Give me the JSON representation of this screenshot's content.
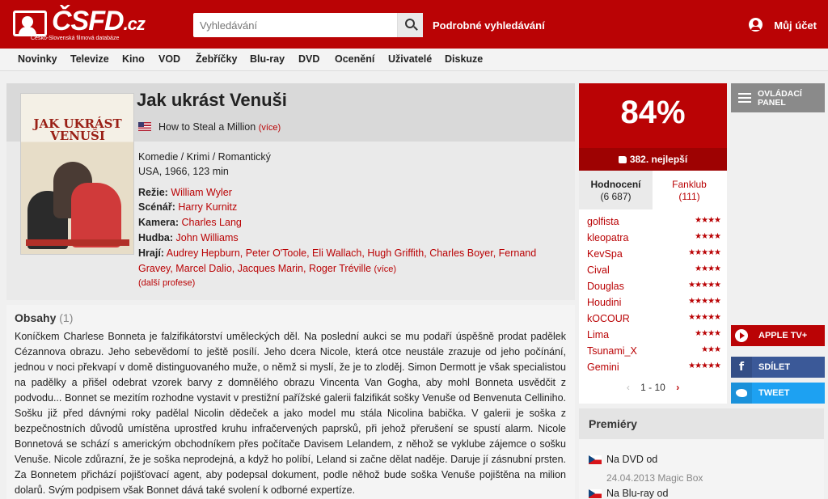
{
  "header": {
    "logo_text": "ČSFD",
    "logo_domain": ".cz",
    "logo_sub": "Česko-Slovenská filmová databáze",
    "search_placeholder": "Vyhledávání",
    "advanced_search": "Podrobné vyhledávání",
    "account": "Můj účet"
  },
  "nav": [
    "Novinky",
    "Televize",
    "Kino",
    "VOD",
    "Žebříčky",
    "Blu-ray",
    "DVD",
    "Ocenění",
    "Uživatelé",
    "Diskuze"
  ],
  "film": {
    "title": "Jak ukrást Venuši",
    "original_title": "How to Steal a Million",
    "more": "(více)",
    "genres": "Komedie / Krimi / Romantický",
    "origin": "USA, 1966, 123 min",
    "poster_title": "JAK UKRÁST VENUŠI",
    "crew": [
      {
        "role": "Režie:",
        "name": "William Wyler"
      },
      {
        "role": "Scénář:",
        "name": "Harry Kurnitz"
      },
      {
        "role": "Kamera:",
        "name": "Charles Lang"
      },
      {
        "role": "Hudba:",
        "name": "John Williams"
      }
    ],
    "actors_label": "Hrají:",
    "actors": "Audrey Hepburn, Peter O'Toole, Eli Wallach, Hugh Griffith, Charles Boyer, Fernand Gravey, Marcel Dalio, Jacques Marin, Roger Tréville",
    "actors_more": "(více)",
    "other_professions": "(další profese)"
  },
  "plot": {
    "heading": "Obsahy",
    "count": "(1)",
    "text": "Koníčkem Charlese Bonneta je falzifikátorství uměleckých děl. Na poslední aukci se mu podaří úspěšně prodat padělek Cézannova obrazu. Jeho sebevědomí to ještě posílí. Jeho dcera Nicole, která otce neustále zrazuje od jeho počínání, jednou v noci překvapí v domě distinguovaného muže, o němž si myslí, že je to zloděj. Simon Dermott je však specialistou na padělky a přišel odebrat vzorek barvy z domnělého obrazu Vincenta Van Gogha, aby mohl Bonneta usvědčit z podvodu... Bonnet se mezitím rozhodne vystavit v prestižní pařížské galerii falzifikát sošky Venuše od Benvenuta Celliniho. Sošku již před dávnými roky padělal Nicolin dědeček a jako model mu stála Nicolina babička. V galerii je soška z bezpečnostních důvodů umístěna uprostřed kruhu infračervených paprsků, při jehož přerušení se spustí alarm. Nicole Bonnetová se schází s americkým obchodníkem přes počítače Davisem Lelandem, z něhož se vyklube zájemce o sošku Venuše. Nicole zdůrazní, že je soška neprodejná, a když ho políbí, Leland si začne dělat naděje. Daruje jí zásnubní prsten. Za Bonnetem přichází pojišťovací agent, aby podepsal dokument, podle něhož bude soška Venuše pojištěna na milion dolarů. Svým podpisem však Bonnet dává také svolení k odborné expertíze."
  },
  "rating": {
    "percent": "84%",
    "rank": "382. nejlepší",
    "tab_ratings_label": "Hodnocení",
    "tab_ratings_count": "(6 687)",
    "tab_fanclub_label": "Fanklub",
    "tab_fanclub_count": "(111)",
    "users": [
      {
        "name": "golfista",
        "stars": "★★★★"
      },
      {
        "name": "kleopatra",
        "stars": "★★★★"
      },
      {
        "name": "KevSpa",
        "stars": "★★★★★"
      },
      {
        "name": "Cival",
        "stars": "★★★★"
      },
      {
        "name": "Douglas",
        "stars": "★★★★★"
      },
      {
        "name": "Houdini",
        "stars": "★★★★★"
      },
      {
        "name": "kOCOUR",
        "stars": "★★★★★"
      },
      {
        "name": "Lima",
        "stars": "★★★★"
      },
      {
        "name": "Tsunami_X",
        "stars": "★★★"
      },
      {
        "name": "Gemini",
        "stars": "★★★★★"
      }
    ],
    "pager": "1 - 10",
    "pager_prev": "‹",
    "pager_next": "›"
  },
  "premieres": {
    "heading": "Premiéry",
    "items": [
      {
        "label": "Na DVD od",
        "date": "24.04.2013 Magic Box"
      },
      {
        "label": "Na Blu-ray od",
        "date": ""
      }
    ]
  },
  "sidebar": {
    "control_panel": "OVLÁDACÍ PANEL",
    "apple_tv": "APPLE TV+",
    "share": "SDÍLET",
    "tweet": "TWEET"
  },
  "colors": {
    "brand": "#ba0305",
    "facebook": "#3b5998",
    "twitter": "#1da1f2"
  }
}
